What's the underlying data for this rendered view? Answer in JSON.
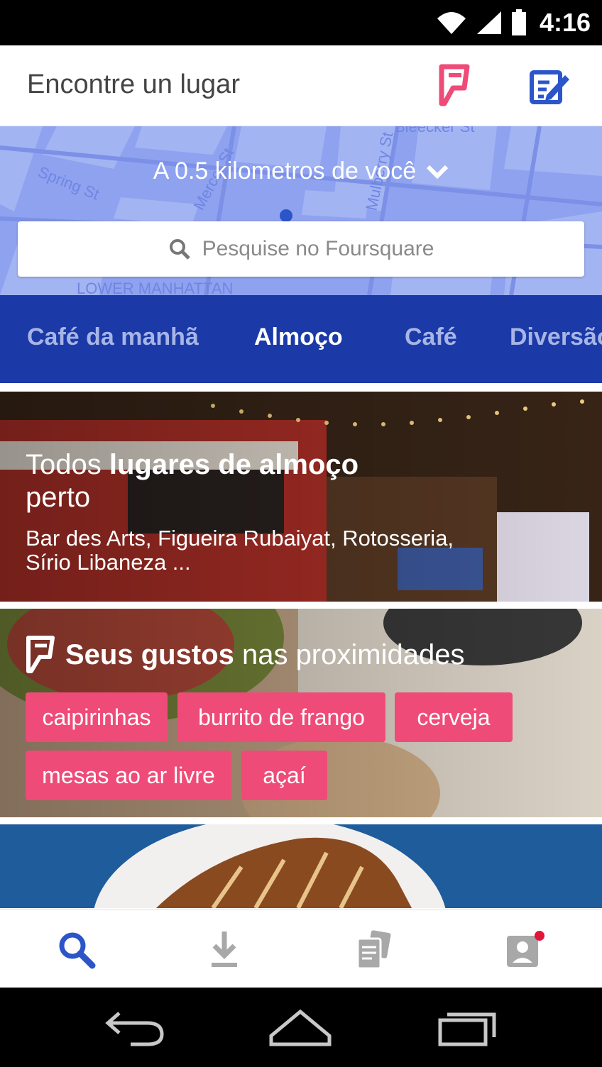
{
  "status_bar": {
    "time": "4:16",
    "icons": [
      "wifi-icon",
      "signal-icon",
      "battery-icon"
    ]
  },
  "header": {
    "title": "Encontre un lugar",
    "logo": "foursquare-logo-icon",
    "action": "compose-icon"
  },
  "map": {
    "distance": "A 0.5 kilometros de você",
    "search_placeholder": "Pesquise no Foursquare",
    "streets": [
      "Spring St",
      "Mercer St",
      "Mulberry St",
      "Bleecker St",
      "LOWER MANHATTAN"
    ]
  },
  "tabs": [
    {
      "label": "Café da manhã",
      "active": false
    },
    {
      "label": "Almoço",
      "active": true
    },
    {
      "label": "Café",
      "active": false
    },
    {
      "label": "Diversão",
      "active": false
    }
  ],
  "cards": {
    "lunch": {
      "title_light": "Todos ",
      "title_bold": "lugares de almoço",
      "title_light2": " perto",
      "subtitle": "Bar des Arts, Figueira Rubaiyat, Rotosseria, Sírio Libaneza ..."
    },
    "tastes": {
      "title_bold": "Seus gustos",
      "title_light": " nas proximidades",
      "chips": [
        "caipirinhas",
        "burrito de frango",
        "cerveja",
        "mesas ao ar livre",
        "açaí"
      ]
    }
  },
  "bottom_nav": [
    "search-icon",
    "download-icon",
    "feed-icon",
    "profile-icon"
  ],
  "system_nav": [
    "back-icon",
    "home-icon",
    "recents-icon"
  ],
  "colors": {
    "brand_blue": "#1b3aa8",
    "brand_pink": "#ef4b78",
    "map_blue": "#8ea2f0",
    "nav_active": "#2b55c9"
  }
}
